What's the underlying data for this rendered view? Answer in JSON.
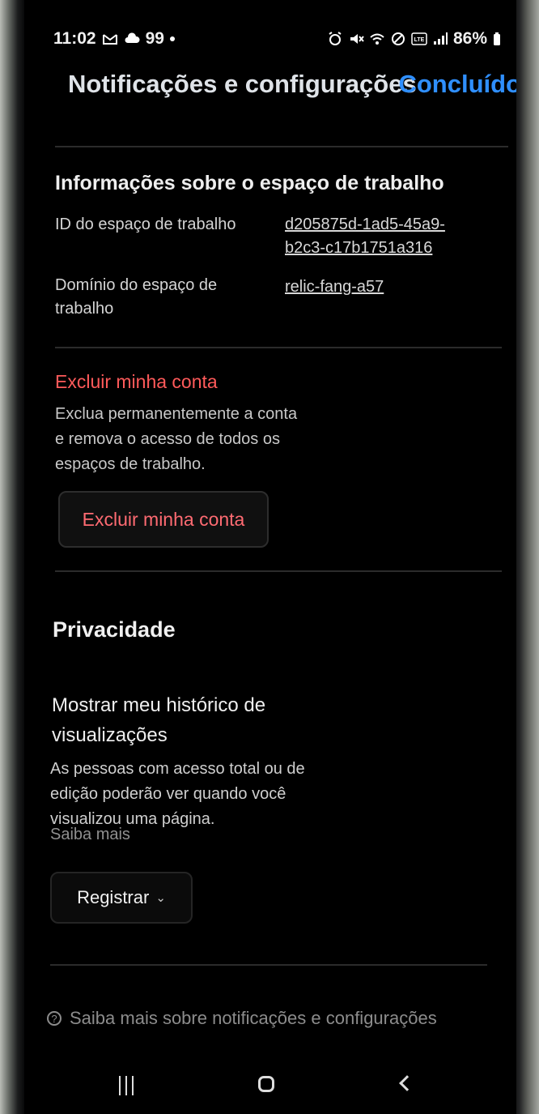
{
  "status_bar": {
    "time": "11:02",
    "left_icons": [
      "gmail-icon",
      "cloud-icon",
      "99"
    ],
    "battery": "86%",
    "right_icons": [
      "alarm-icon",
      "mute-icon",
      "wifi-icon",
      "do-not-disturb-icon",
      "volte-icon",
      "signal-icon",
      "battery-icon"
    ]
  },
  "header": {
    "title": "Notificações e configurações",
    "done_label": "Concluído"
  },
  "workspace_info": {
    "title": "Informações sobre o espaço de trabalho",
    "id_label": "ID do espaço de trabalho",
    "id_value": "d205875d-1ad5-45a9-b2c3-c17b1751a316",
    "domain_label": "Domínio do espaço de trabalho",
    "domain_value": "relic-fang-a57"
  },
  "delete_account": {
    "title": "Excluir minha conta",
    "description": "Exclua permanentemente a conta e remova o acesso de todos os espaços de trabalho.",
    "button_label": "Excluir minha conta"
  },
  "privacy": {
    "title": "Privacidade",
    "history_title": "Mostrar meu histórico de visualizações",
    "history_desc": "As pessoas com acesso total ou de edição poderão ver quando você visualizou uma página.",
    "learn_more": "Saiba mais",
    "select_value": "Registrar"
  },
  "footer": {
    "help_text": "Saiba mais sobre notificações e configurações"
  },
  "nav": {
    "recent": "recent-apps-icon",
    "home": "home-icon",
    "back": "back-icon"
  }
}
